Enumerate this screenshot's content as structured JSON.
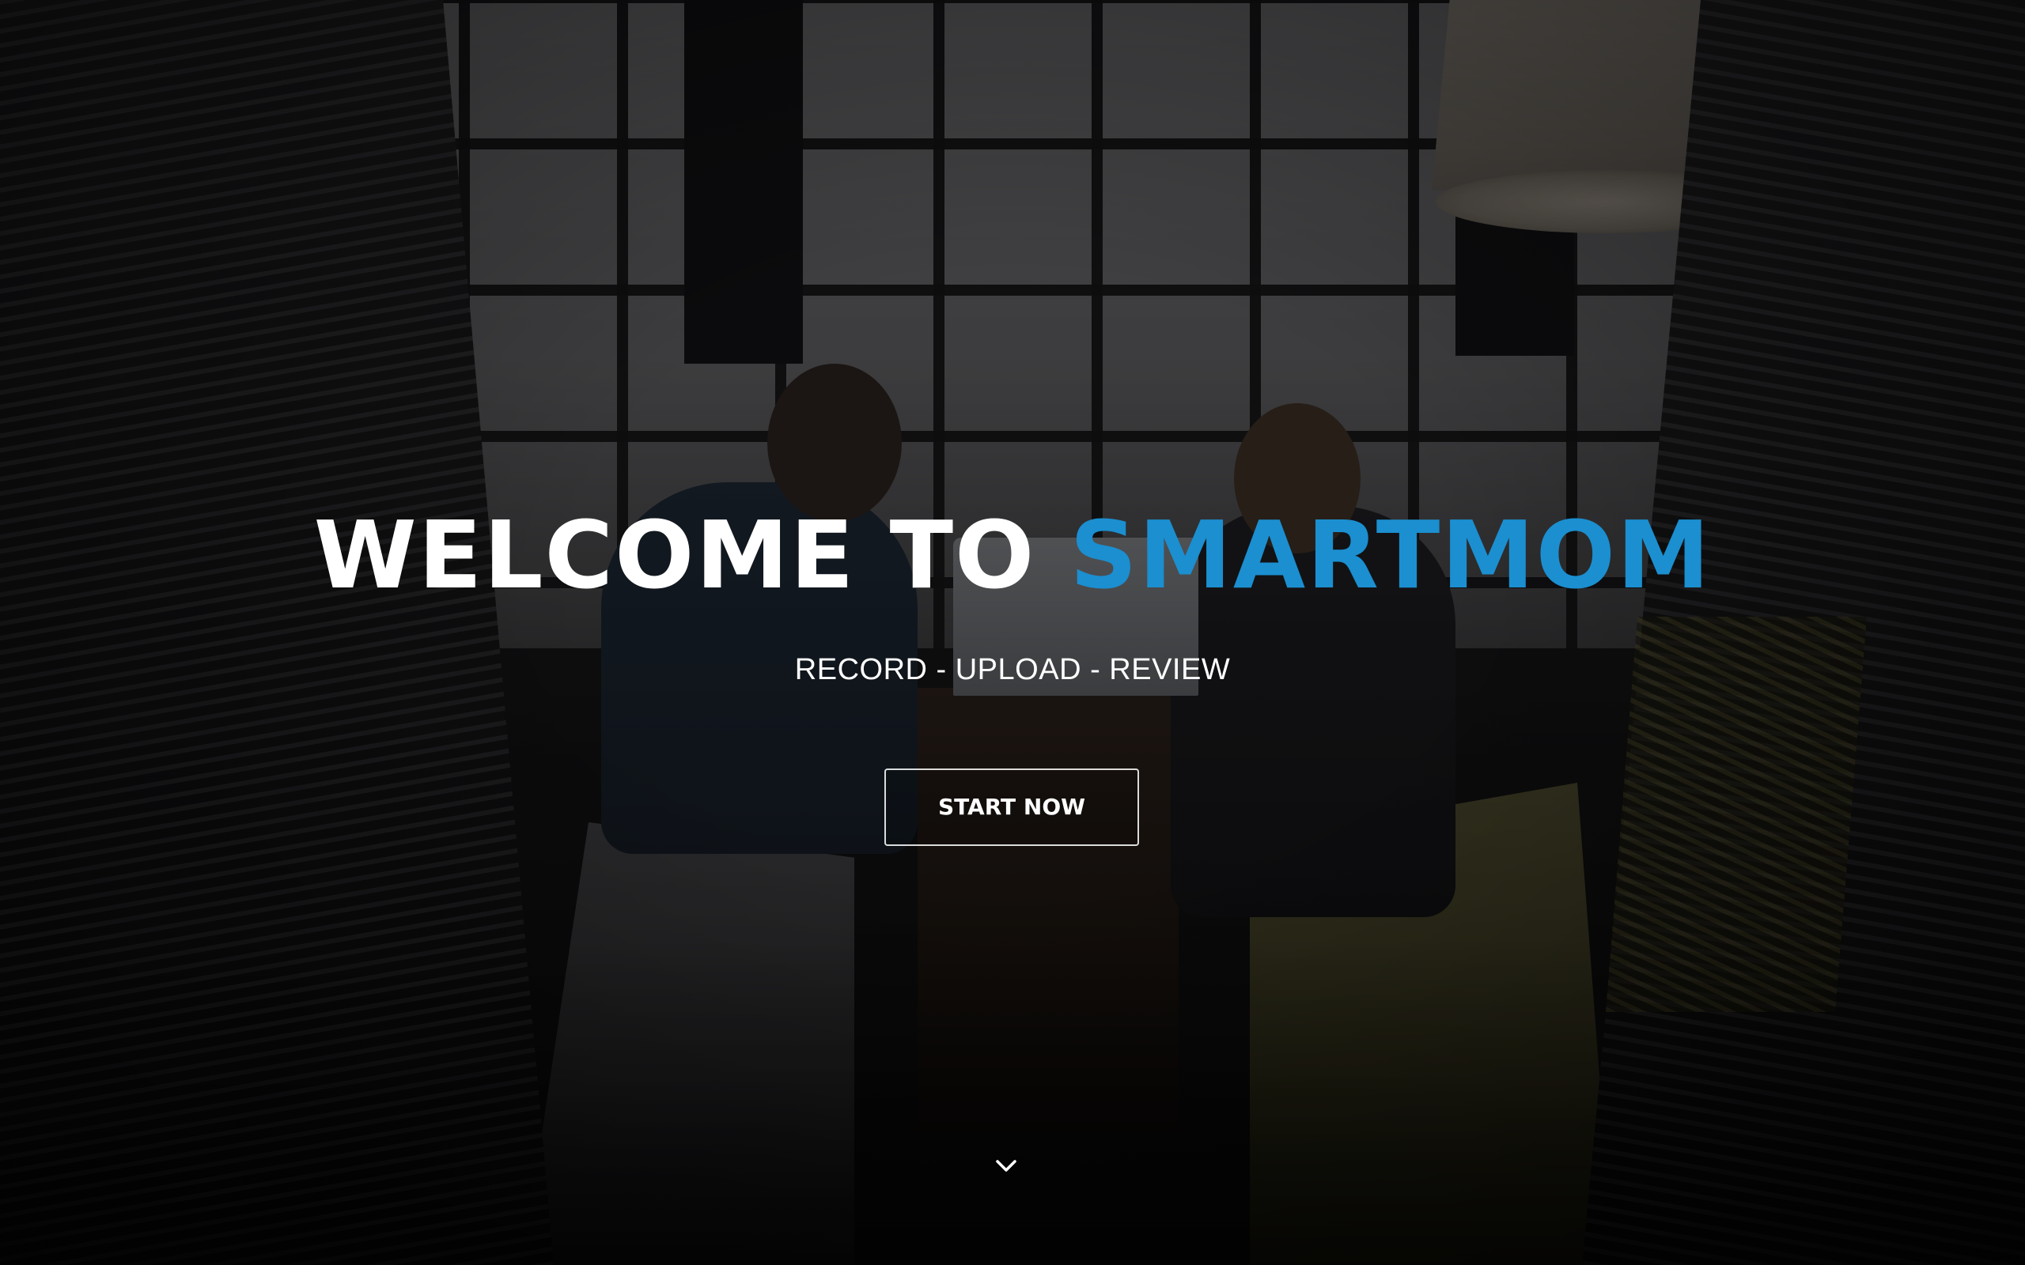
{
  "hero": {
    "headline_lead": "WELCOME TO ",
    "headline_brand": "SMARTMOM",
    "tagline": "RECORD - UPLOAD - REVIEW",
    "cta_label": "START NOW",
    "scroll_icon": "chevron-down-icon"
  },
  "colors": {
    "brand_accent": "#1b8fd0",
    "text": "#ffffff",
    "overlay": "rgba(0,0,0,0.35)"
  }
}
